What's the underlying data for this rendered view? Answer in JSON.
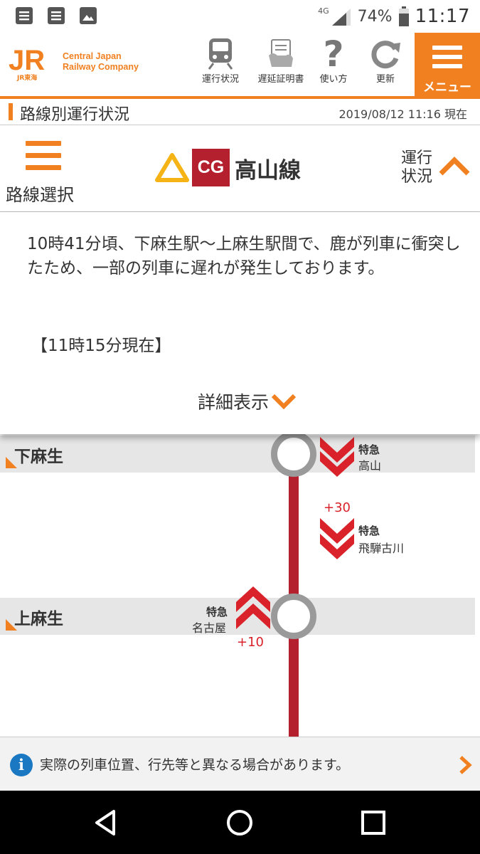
{
  "status_bar": {
    "network": "4G",
    "battery": "74%",
    "time": "11:17",
    "left_icons": [
      "notes-icon",
      "notes-icon",
      "image-icon"
    ]
  },
  "header": {
    "logo_mark": "JR",
    "logo_sub": "JR東海",
    "company_name": "Central Japan\nRailway Company",
    "buttons": [
      {
        "label": "運行状況",
        "icon": "train-icon"
      },
      {
        "label": "遅延証明書",
        "icon": "certificate-icon"
      },
      {
        "label": "使い方",
        "icon": "help-icon"
      },
      {
        "label": "更新",
        "icon": "refresh-icon"
      }
    ],
    "menu_label": "メニュー"
  },
  "page": {
    "title": "路線別運行状況",
    "timestamp": "2019/08/12 11:16 現在"
  },
  "route": {
    "select_label": "路線選択",
    "line_code": "CG",
    "line_name": "高山線",
    "status_label": "運行\n状況"
  },
  "message": {
    "text": "10時41分頃、下麻生駅〜上麻生駅間で、鹿が列車に衝突したため、一部の列車に遅れが発生しております。",
    "time_note": "【11時15分現在】",
    "detail_label": "詳細表示"
  },
  "map": {
    "stations": [
      {
        "name": "下麻生"
      },
      {
        "name": "上麻生"
      }
    ],
    "trains": [
      {
        "type": "特急",
        "destination": "高山",
        "delay": "",
        "direction": "down"
      },
      {
        "type": "特急",
        "destination": "飛騨古川",
        "delay": "+30",
        "direction": "down"
      },
      {
        "type": "特急",
        "destination": "名古屋",
        "delay": "+10",
        "direction": "up"
      }
    ]
  },
  "notice": {
    "text": "実際の列車位置、行先等と異なる場合があります。"
  },
  "colors": {
    "brand_orange": "#f08020",
    "line_red": "#b5202e",
    "train_red": "#d9222a",
    "alert_yellow": "#f5b316",
    "info_blue": "#1a78c2"
  }
}
